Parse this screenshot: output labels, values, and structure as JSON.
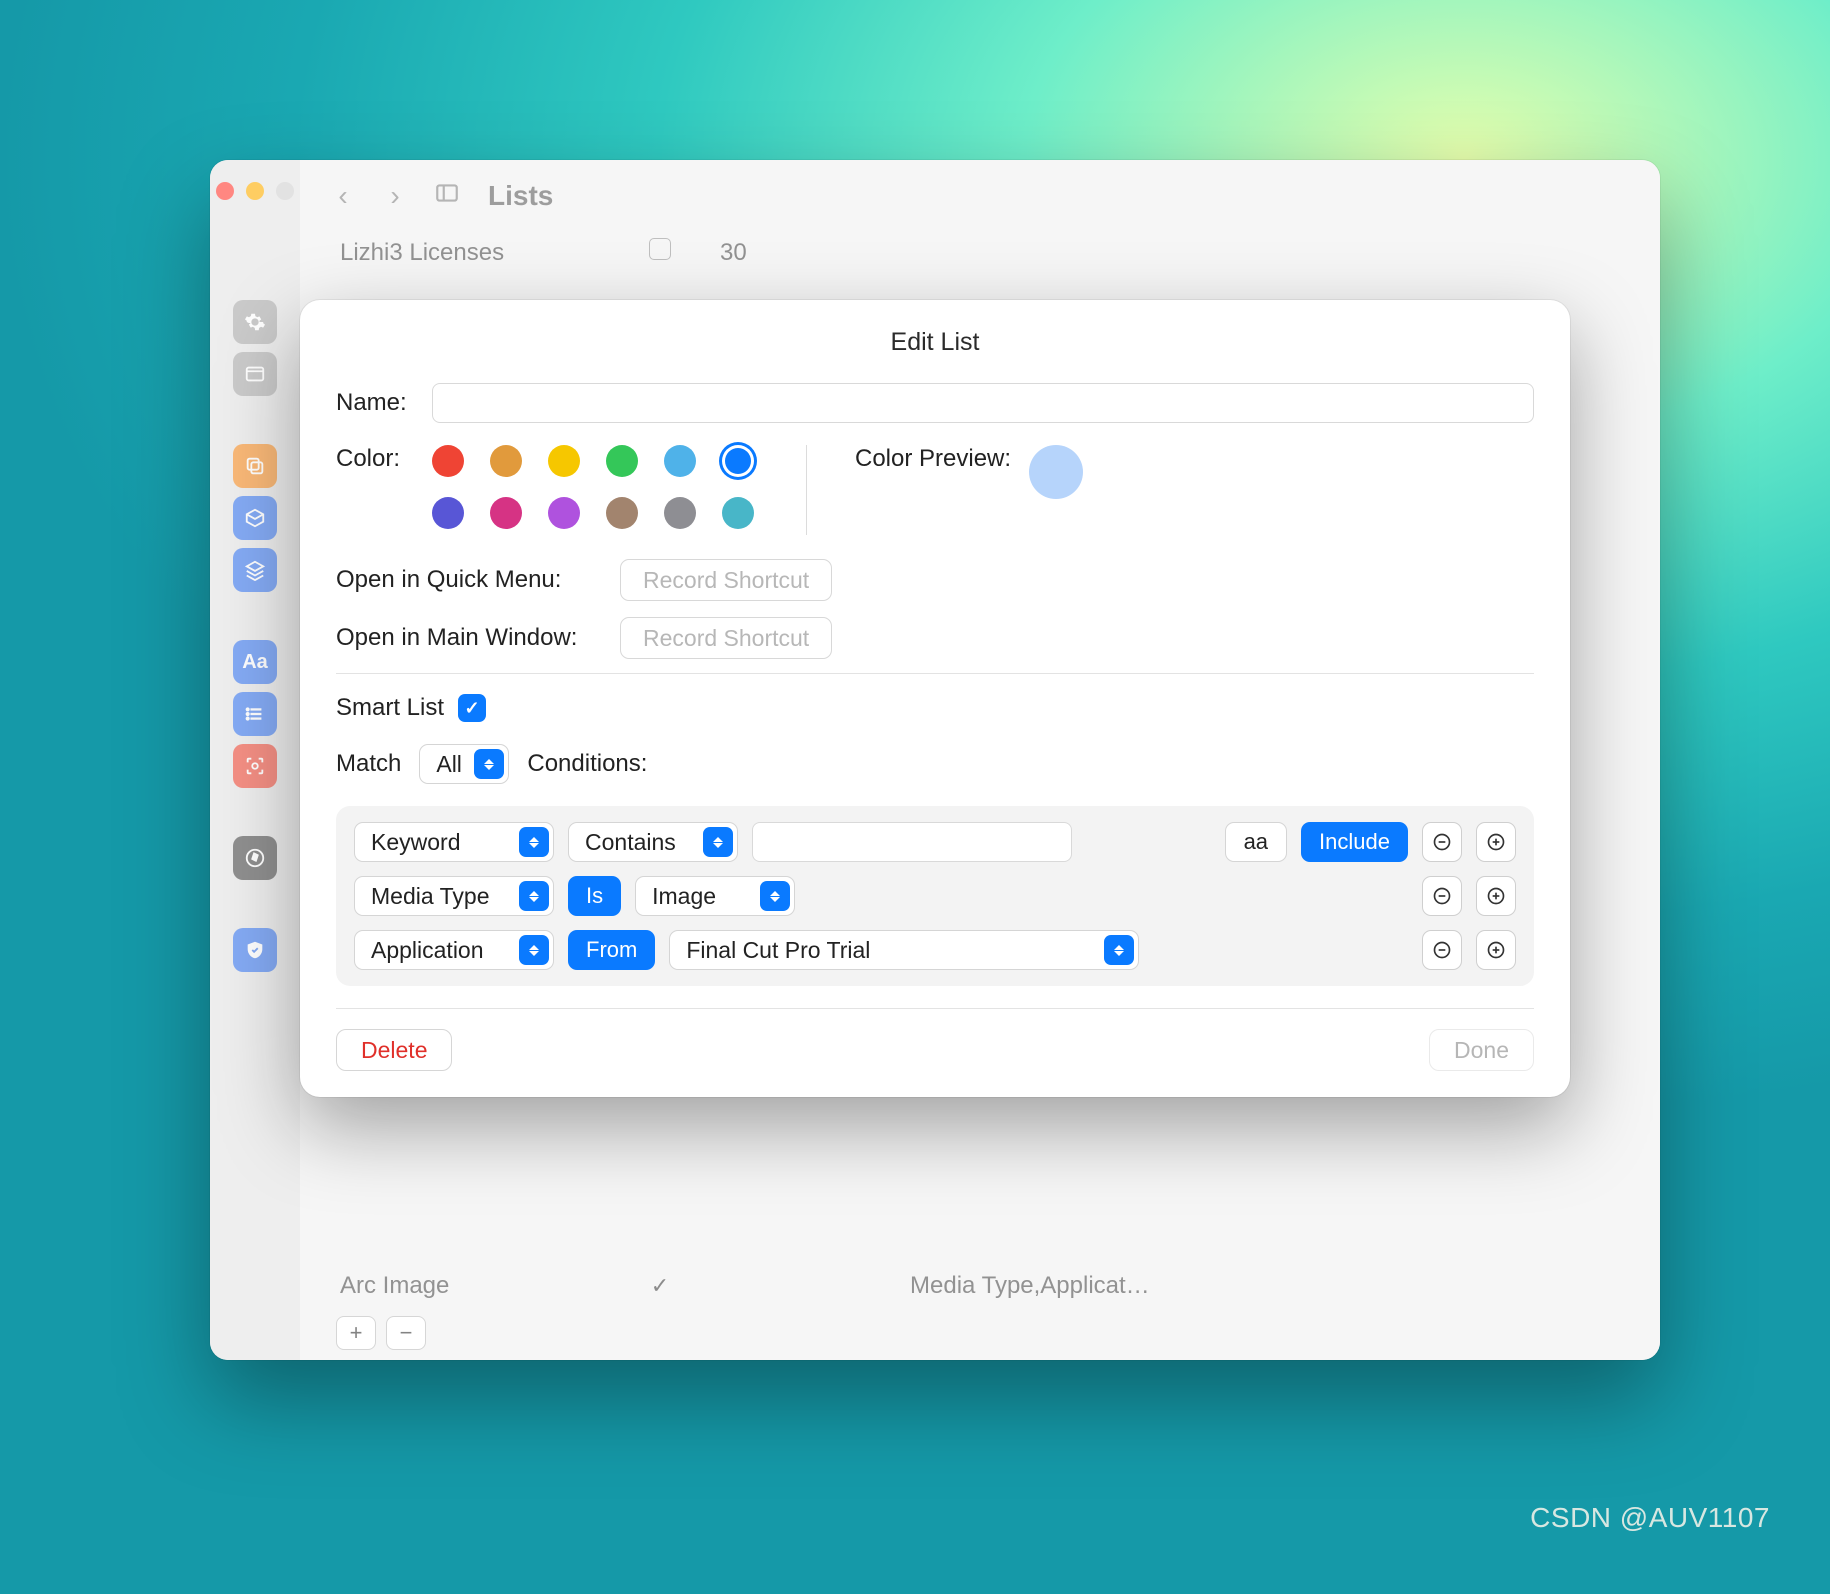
{
  "watermark": "CSDN @AUV1107",
  "window": {
    "title": "Lists",
    "rows": [
      {
        "name": "Lizhi3 Licenses",
        "checked": false,
        "count": "30",
        "meta": ""
      },
      {
        "name": "Arc Image",
        "checked": true,
        "count": "",
        "meta": "Media Type,Applicat…"
      }
    ],
    "sidebar_icons": [
      "gear",
      "window",
      "copy",
      "box",
      "layers",
      "Aa",
      "list",
      "scan",
      "compass",
      "shield"
    ]
  },
  "sheet": {
    "title": "Edit List",
    "labels": {
      "name": "Name:",
      "color": "Color:",
      "color_preview": "Color Preview:",
      "open_quick": "Open in Quick Menu:",
      "open_main": "Open in Main Window:",
      "record_shortcut": "Record Shortcut",
      "smart_list": "Smart List",
      "match": "Match",
      "conditions": "Conditions:"
    },
    "name_value": "",
    "smart_list_checked": true,
    "match_value": "All",
    "colors_row1": [
      {
        "hex": "#ef4434",
        "id": "red"
      },
      {
        "hex": "#e19a3c",
        "id": "orange"
      },
      {
        "hex": "#f6c700",
        "id": "yellow"
      },
      {
        "hex": "#34c759",
        "id": "green"
      },
      {
        "hex": "#4fb2e9",
        "id": "skyblue"
      },
      {
        "hex": "#0a7aff",
        "id": "blue",
        "selected": true
      }
    ],
    "colors_row2": [
      {
        "hex": "#5856d6",
        "id": "indigo"
      },
      {
        "hex": "#d63384",
        "id": "magenta"
      },
      {
        "hex": "#af52de",
        "id": "purple"
      },
      {
        "hex": "#a2846e",
        "id": "brown"
      },
      {
        "hex": "#8e8e93",
        "id": "gray"
      },
      {
        "hex": "#48b6c8",
        "id": "teal"
      }
    ],
    "preview_color": "#b6d4fb",
    "conditions_rows": [
      {
        "field": "Keyword",
        "op": "Contains",
        "value": "",
        "extras": [
          "aa",
          "Include"
        ],
        "op_style": "select"
      },
      {
        "field": "Media Type",
        "op": "Is",
        "value": "Image",
        "op_style": "pill",
        "value_style": "select"
      },
      {
        "field": "Application",
        "op": "From",
        "value": "Final Cut Pro Trial",
        "op_style": "pill",
        "value_style": "select-wide"
      }
    ],
    "footer": {
      "delete": "Delete",
      "done": "Done"
    }
  }
}
